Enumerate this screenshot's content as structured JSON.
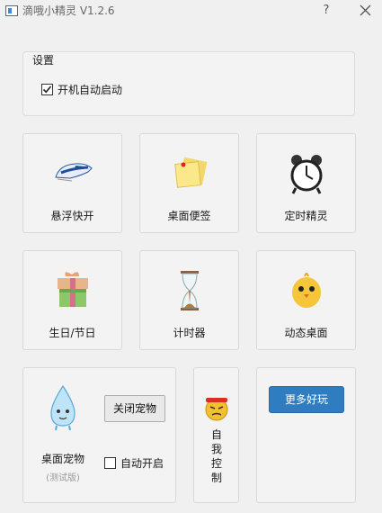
{
  "window": {
    "title": "滴哦小精灵 V1.2.6",
    "help_label": "?"
  },
  "settings": {
    "title": "设置",
    "autostart_label": "开机自动启动",
    "autostart_checked": true
  },
  "tiles": [
    {
      "label": "悬浮快开",
      "icon": "train-icon"
    },
    {
      "label": "桌面便签",
      "icon": "sticky-notes-icon"
    },
    {
      "label": "定时精灵",
      "icon": "alarm-clock-icon"
    },
    {
      "label": "生日/节日",
      "icon": "gift-box-icon"
    },
    {
      "label": "计时器",
      "icon": "hourglass-icon"
    },
    {
      "label": "动态桌面",
      "icon": "chick-icon"
    }
  ],
  "pet": {
    "label": "桌面宠物",
    "sublabel": "(测试版)",
    "close_button": "关闭宠物",
    "autoopen_label": "自动开启",
    "autoopen_checked": false,
    "icon": "water-drop-icon"
  },
  "self_control": {
    "label": "自我控制",
    "icon": "angry-face-icon"
  },
  "more": {
    "button": "更多好玩"
  }
}
